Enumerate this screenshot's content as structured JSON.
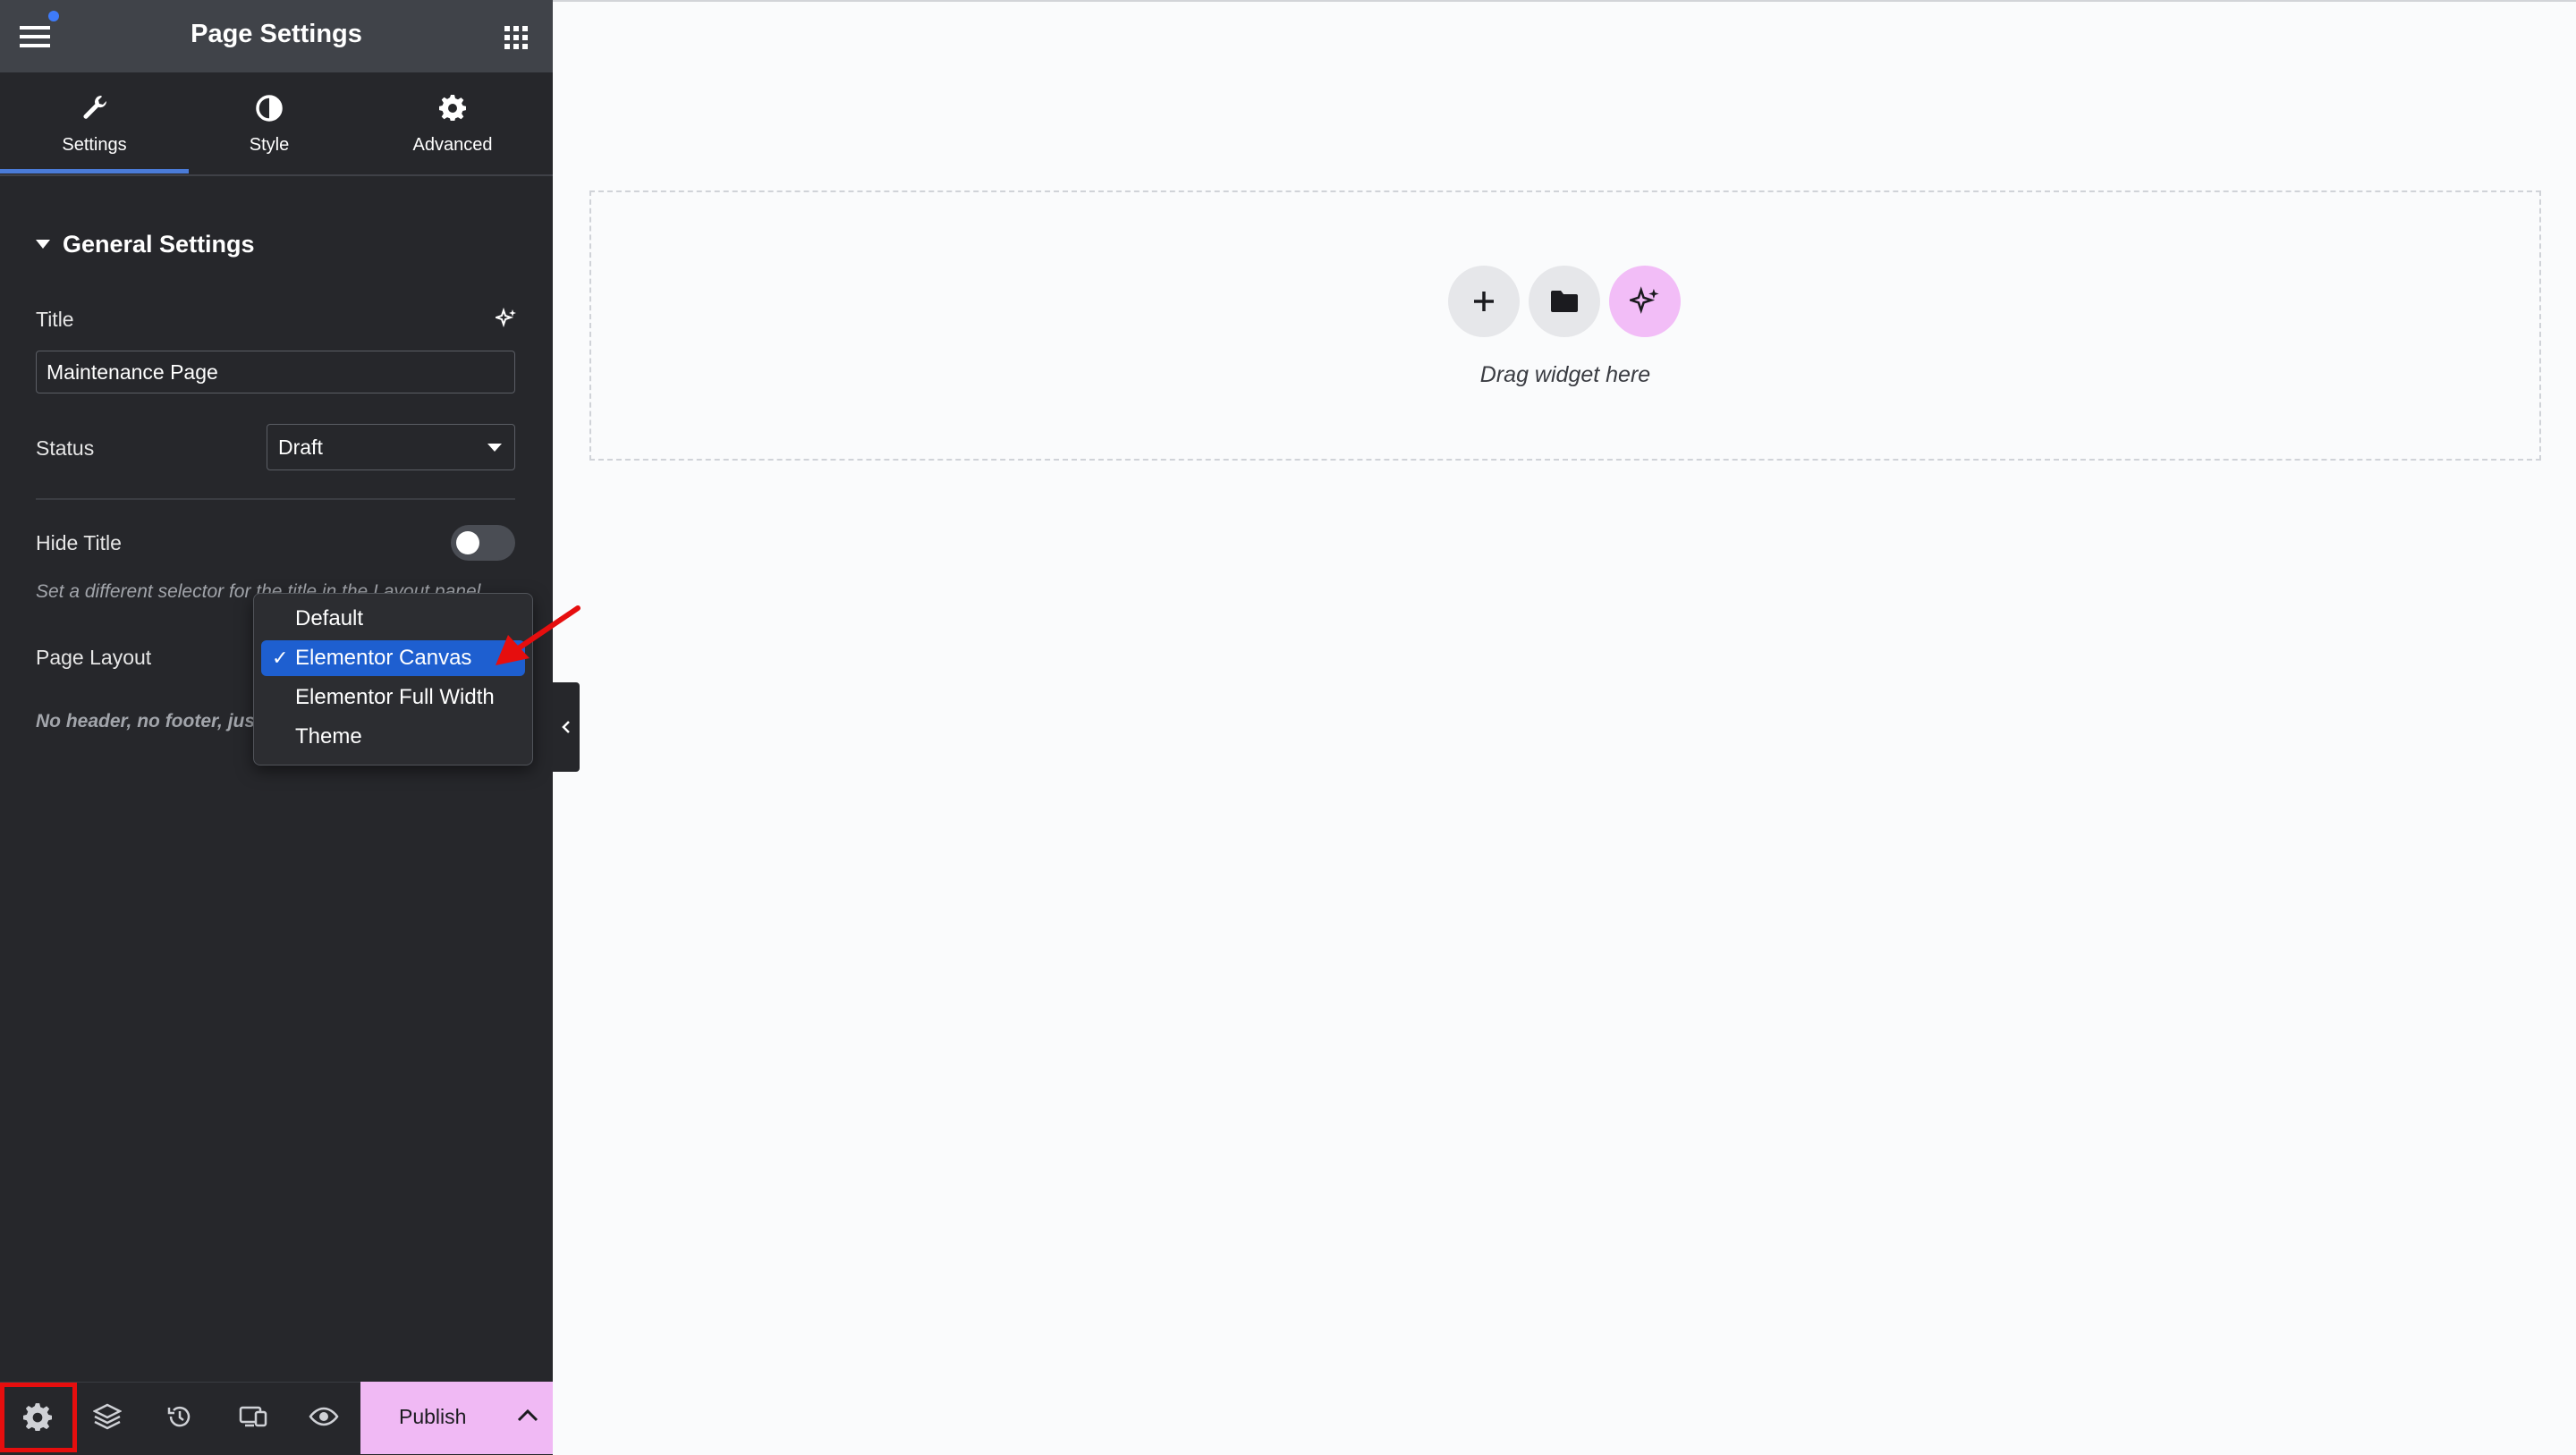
{
  "panel": {
    "title": "Page Settings",
    "tabs": [
      {
        "label": "Settings",
        "icon": "wrench-icon",
        "active": true
      },
      {
        "label": "Style",
        "icon": "half-circle-icon",
        "active": false
      },
      {
        "label": "Advanced",
        "icon": "gear-icon",
        "active": false
      }
    ],
    "section_title": "General Settings",
    "title_field": {
      "label": "Title",
      "value": "Maintenance Page"
    },
    "status_field": {
      "label": "Status",
      "value": "Draft"
    },
    "hide_title": {
      "label": "Hide Title",
      "enabled": false,
      "help": "Set a different selector for the title in the Layout panel."
    },
    "page_layout": {
      "label": "Page Layout",
      "help": "No header, no footer, just Elementor",
      "options": [
        "Default",
        "Elementor Canvas",
        "Elementor Full Width",
        "Theme"
      ],
      "selected": "Elementor Canvas",
      "check_glyph": "✓"
    }
  },
  "bottom_bar": {
    "icons": [
      "gear-icon",
      "layers-icon",
      "history-icon",
      "responsive-icon",
      "eye-icon"
    ],
    "publish_label": "Publish"
  },
  "canvas": {
    "drop_text": "Drag widget here"
  },
  "colors": {
    "panel_bg": "#26272b",
    "topbar_bg": "#404349",
    "accent_blue": "#1e5fd0",
    "publish_bg": "#f0b9f4",
    "highlight_red": "#e60e0e"
  }
}
